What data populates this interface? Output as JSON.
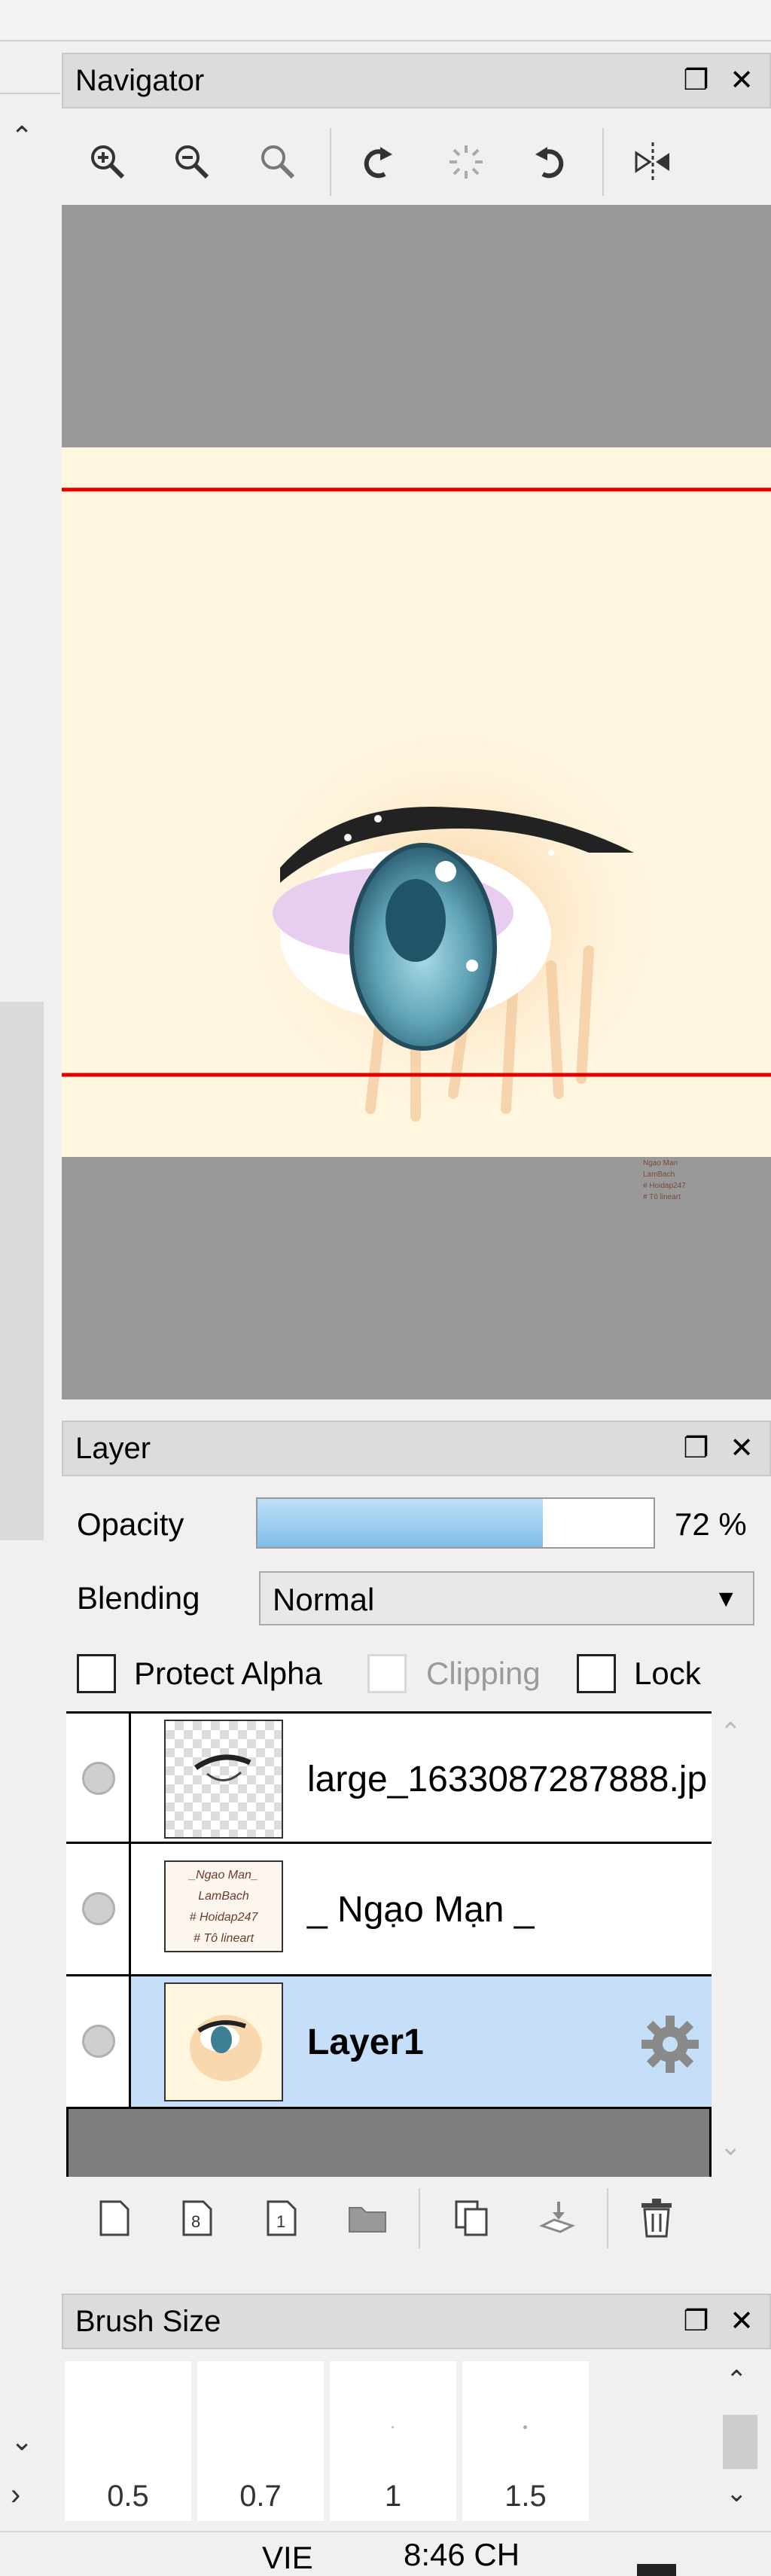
{
  "navigator": {
    "title": "Navigator"
  },
  "layer_panel": {
    "title": "Layer",
    "opacity_label": "Opacity",
    "opacity_value": "72 %",
    "opacity_fraction": 0.72,
    "blending_label": "Blending",
    "blending_value": "Normal",
    "protect_alpha_label": "Protect Alpha",
    "clipping_label": "Clipping",
    "lock_label": "Lock",
    "layers": [
      {
        "name": "large_1633087287888.jp",
        "selected": false
      },
      {
        "name": "_ Ngạo Mạn _",
        "selected": false
      },
      {
        "name": "Layer1",
        "selected": true
      }
    ],
    "thumb_text": [
      "_Ngao Man_",
      "LamBach",
      "# Hoidap247",
      "# Tô lineart"
    ]
  },
  "brush_size": {
    "title": "Brush Size",
    "sizes": [
      "0.5",
      "0.7",
      "1",
      "1.5"
    ]
  },
  "taskbar": {
    "language": "VIE",
    "time": "8:46 CH"
  },
  "colors": {
    "accent_selected": "#c5dff8",
    "opacity_fill": "#8cc6ef",
    "canvas_bg": "#fff8e6",
    "guide_line": "#e00000"
  }
}
